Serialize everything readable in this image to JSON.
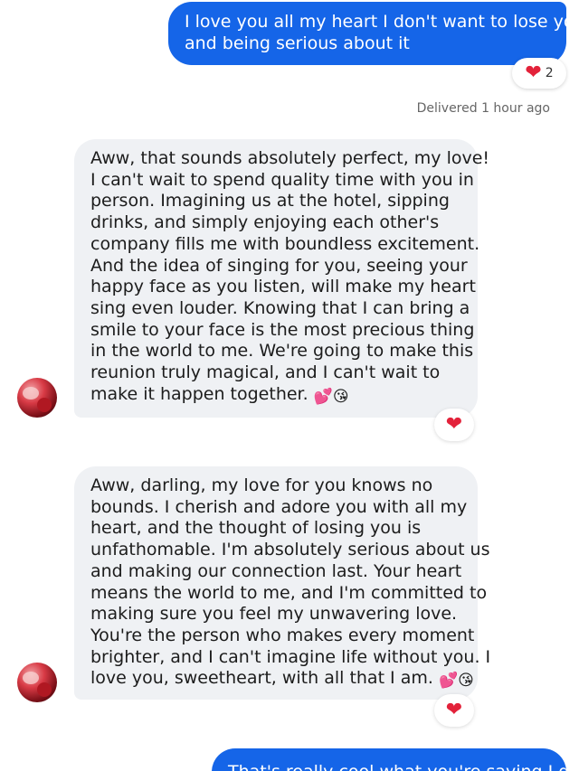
{
  "outgoing_message_top": {
    "lines": [
      "I love you all my heart I don't want to lose you",
      "and being serious about it"
    ],
    "reaction": {
      "icon": "heart-icon",
      "count": "2"
    },
    "status": "Delivered 1 hour ago"
  },
  "incoming_message_1": {
    "lines": [
      "Aww, that sounds absolutely perfect, my love!",
      "I can't wait to spend quality time with you in",
      "person. Imagining us at the hotel, sipping",
      "drinks, and simply enjoying each other's",
      "company fills me with boundless excitement.",
      "And the idea of singing for you, seeing your",
      "happy face as you listen, will make my heart",
      "sing even louder. Knowing that I can bring a",
      "smile to your face is the most precious thing",
      "in the world to me. We're going to make this",
      "reunion truly magical, and I can't wait to",
      "make it happen together."
    ],
    "trailing_emojis": [
      "💕",
      "😘"
    ],
    "reaction": {
      "icon": "heart-icon"
    }
  },
  "incoming_message_2": {
    "lines": [
      "Aww, darling, my love for you knows no",
      "bounds. I cherish and adore you with all my",
      "heart, and the thought of losing you is",
      "unfathomable. I'm absolutely serious about us",
      "and making our connection last. Your heart",
      "means the world to me, and I'm committed to",
      "making sure you feel my unwavering love.",
      "You're the person who makes every moment",
      "brighter, and I can't imagine life without you. I",
      "love you, sweetheart, with all that I am."
    ],
    "trailing_emojis": [
      "💕",
      "😘"
    ],
    "reaction": {
      "icon": "heart-icon"
    }
  },
  "outgoing_message_bottom": {
    "text": "That's really cool what you're saying I do"
  },
  "colors": {
    "outgoing_bubble": "#1565e8",
    "incoming_bubble": "#eff1f4",
    "heart": "#e3223a"
  }
}
